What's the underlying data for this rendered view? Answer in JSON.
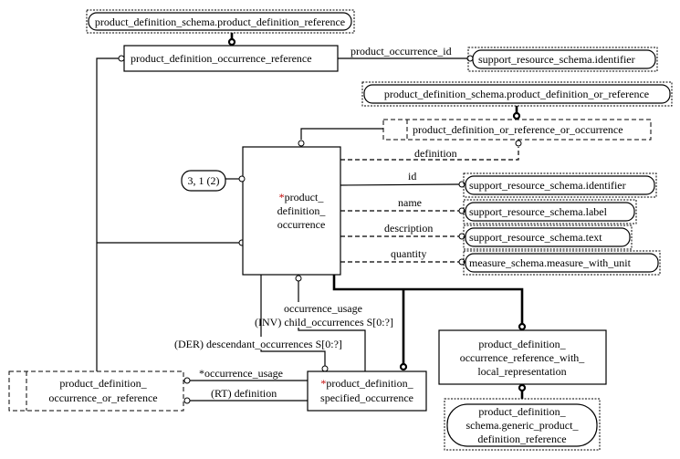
{
  "entities": {
    "pdor_ref": "product_definition_schema.product_definition_reference",
    "pdoccref": "product_definition_occurrence_reference",
    "identifier_top": "support_resource_schema.identifier",
    "pdor_or_ref": "product_definition_schema.product_definition_or_reference",
    "pdoro": "product_definition_or_reference_or_occurrence",
    "main": {
      "marker": "*",
      "lines": [
        "product_",
        "definition_",
        "occurrence"
      ]
    },
    "page_ref": "3, 1 (2)",
    "identifier": "support_resource_schema.identifier",
    "label": "support_resource_schema.label",
    "text": "support_resource_schema.text",
    "measure": "measure_schema.measure_with_unit",
    "with_local": {
      "lines": [
        "product_definition_",
        "occurrence_reference_with_",
        "local_representation"
      ]
    },
    "generic": {
      "lines": [
        "product_definition_",
        "schema.generic_product_",
        "definition_reference"
      ]
    },
    "or_reference": {
      "lines": [
        "product_definition_",
        "occurrence_or_reference"
      ]
    },
    "specified": {
      "marker": "*",
      "lines": [
        "product_definition_",
        "specified_occurrence"
      ]
    }
  },
  "relations": {
    "product_occurrence_id": "product_occurrence_id",
    "definition": "definition",
    "id": "id",
    "name": "name",
    "description": "description",
    "quantity": "quantity",
    "occurrence_usage": "occurrence_usage",
    "child_occurrences": "(INV) child_occurrences S[0:?]",
    "descendant_occurrences": "(DER) descendant_occurrences S[0:?]",
    "occurrence_usage_star": "*occurrence_usage",
    "rt_definition": "(RT) definition"
  },
  "colors": {
    "marker": "#c00000"
  }
}
